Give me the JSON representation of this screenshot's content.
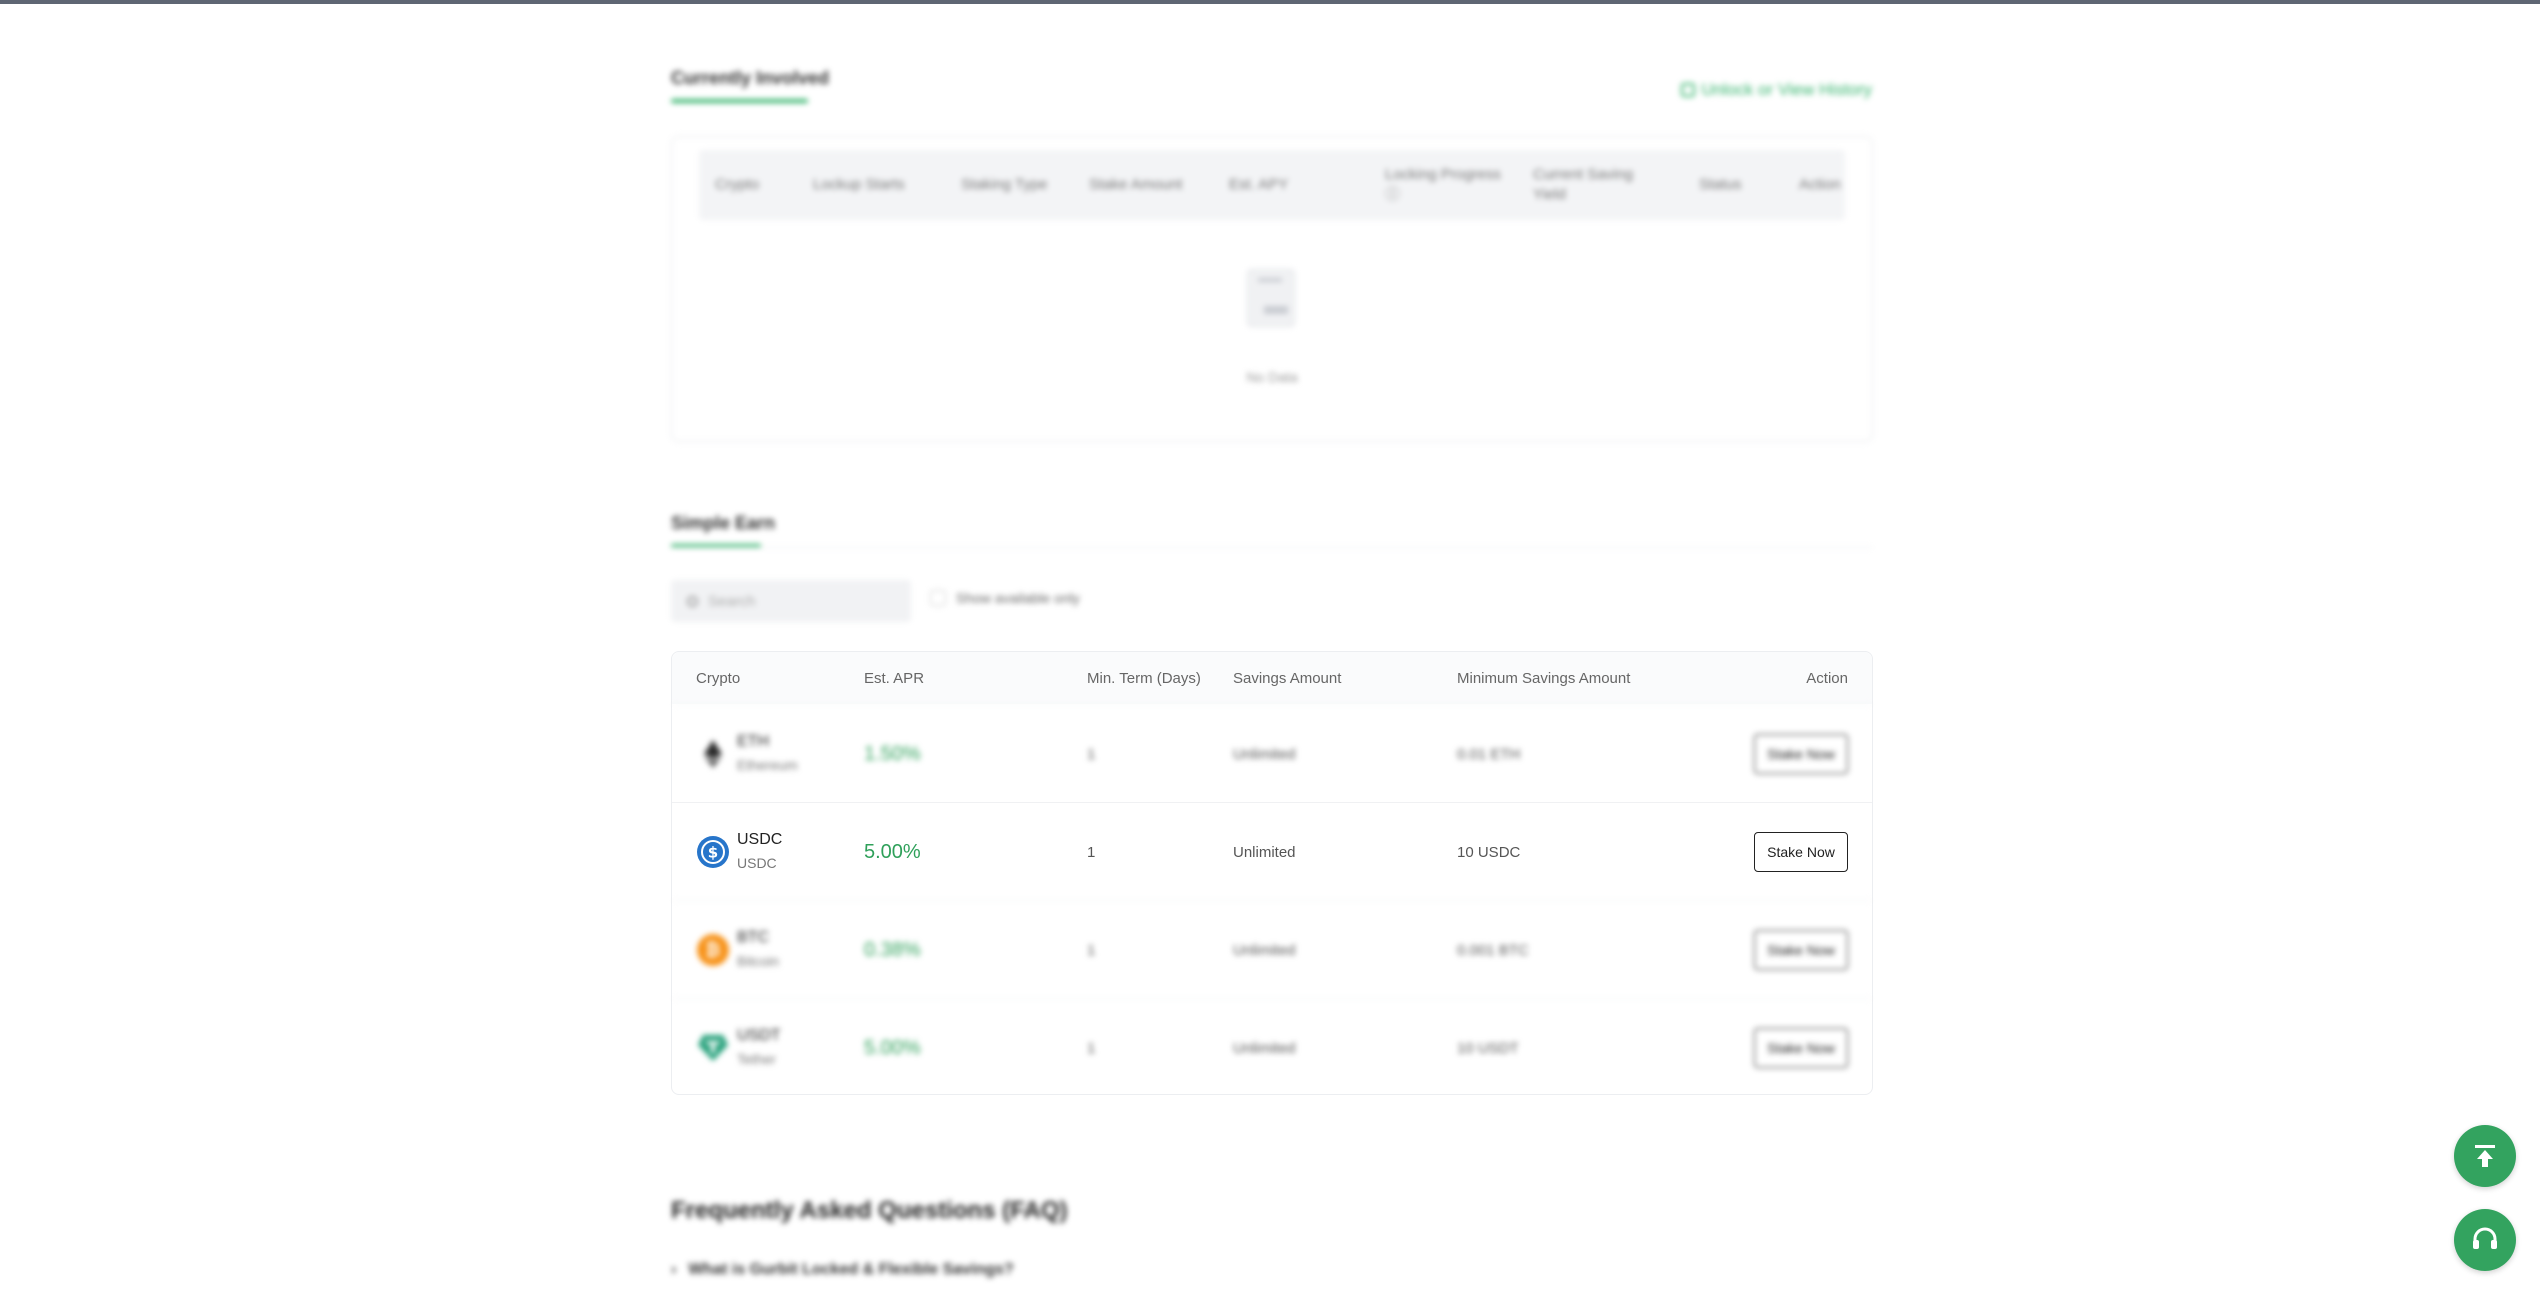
{
  "currently_involved": {
    "tab_label": "Currently Involved",
    "history_link": "Unlock or View History",
    "columns": [
      "Crypto",
      "Lockup Starts",
      "Staking Type",
      "Stake Amount",
      "Est. APY",
      "Locking Progress ⓘ",
      "Current Saving Yield",
      "Status",
      "Action"
    ],
    "empty_text": "No Data"
  },
  "simple_earn": {
    "tab_label": "Simple Earn",
    "search_placeholder": "Search",
    "show_available_label": "Show available only",
    "columns": {
      "crypto": "Crypto",
      "apr": "Est. APR",
      "term": "Min. Term (Days)",
      "savings": "Savings Amount",
      "min_savings": "Minimum Savings Amount",
      "action": "Action"
    },
    "rows": [
      {
        "symbol": "ETH",
        "name": "Ethereum",
        "apr": "1.50%",
        "term": "1",
        "savings": "Unlimited",
        "min": "0.01 ETH",
        "button": "Stake Now",
        "icon": "ethereum-icon",
        "color": "#2b2b2b"
      },
      {
        "symbol": "USDC",
        "name": "USDC",
        "apr": "5.00%",
        "term": "1",
        "savings": "Unlimited",
        "min": "10 USDC",
        "button": "Stake Now",
        "icon": "usdc-icon",
        "color": "#2775ca"
      },
      {
        "symbol": "BTC",
        "name": "Bitcoin",
        "apr": "0.38%",
        "term": "1",
        "savings": "Unlimited",
        "min": "0.001 BTC",
        "button": "Stake Now",
        "icon": "bitcoin-icon",
        "color": "#f7931a"
      },
      {
        "symbol": "USDT",
        "name": "Tether",
        "apr": "5.00%",
        "term": "1",
        "savings": "Unlimited",
        "min": "10 USDT",
        "button": "Stake Now",
        "icon": "tether-icon",
        "color": "#26a17b"
      }
    ]
  },
  "faq": {
    "title": "Frequently Asked Questions (FAQ)",
    "first_question": "What is Gurbit Locked & Flexible Savings?"
  },
  "colors": {
    "accent": "#33a35f",
    "apr": "#2fa05a"
  }
}
